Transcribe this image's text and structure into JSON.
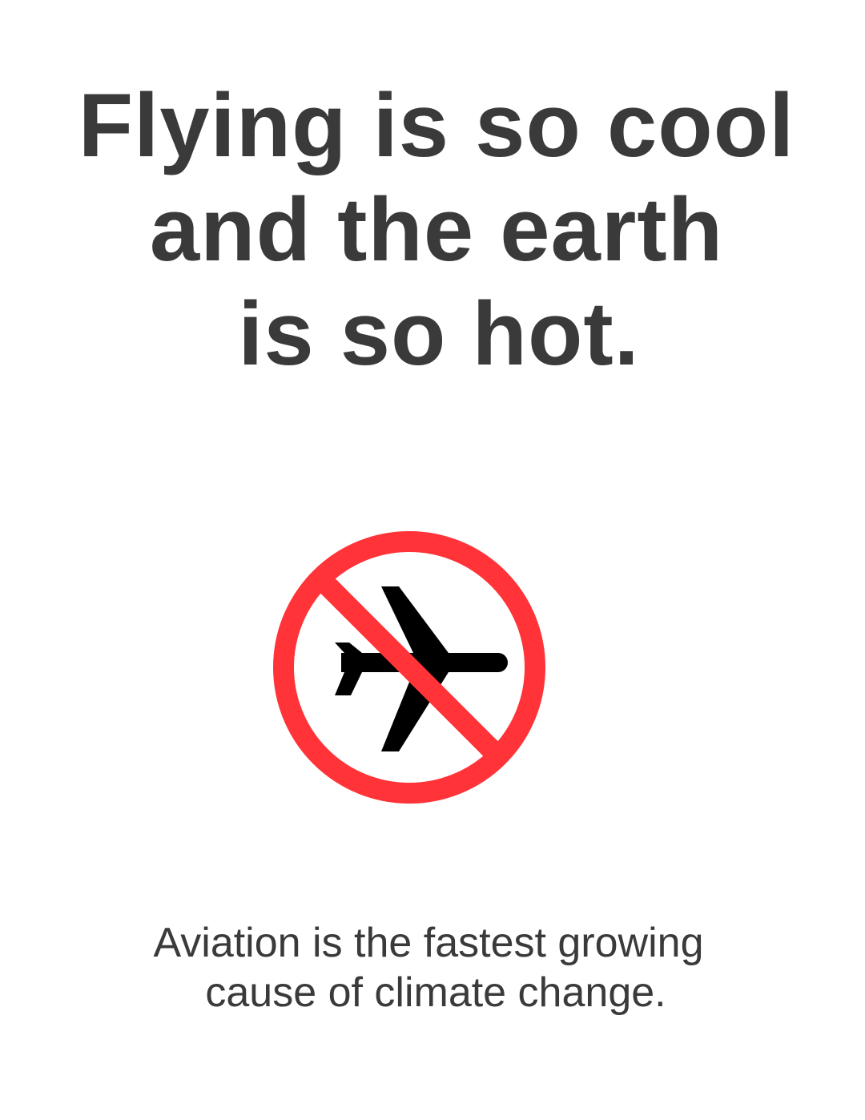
{
  "headline": {
    "lines": [
      "Flying is so cool",
      "and the earth",
      "is so hot."
    ]
  },
  "sign": {
    "icon": "no-flying-icon",
    "ring_color": "#ff3338",
    "plane_color": "#000000"
  },
  "tagline": {
    "lines": [
      "Aviation is the fastest growing",
      "cause of climate change."
    ]
  },
  "colors": {
    "text": "#3a3a3a",
    "background": "#ffffff"
  }
}
